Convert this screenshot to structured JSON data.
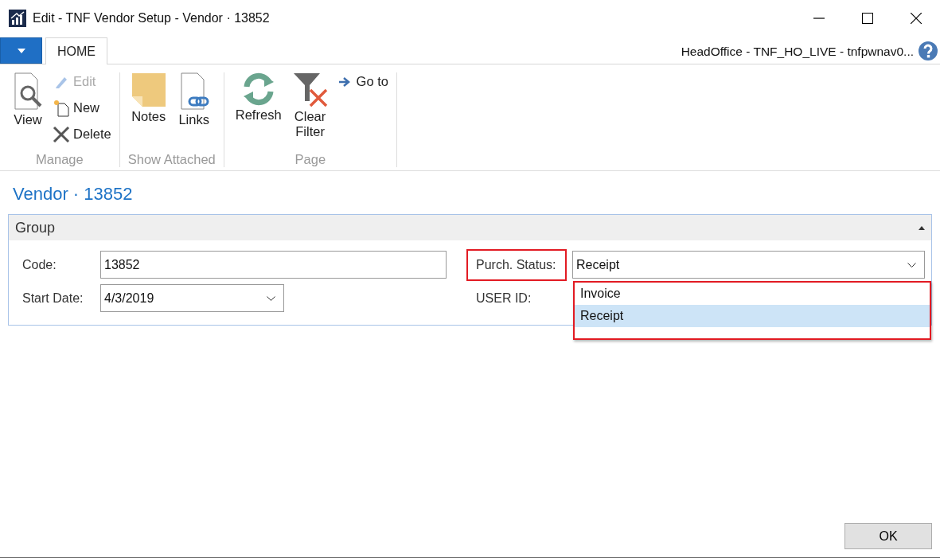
{
  "window": {
    "title": "Edit - TNF Vendor Setup - Vendor · 13852"
  },
  "tabs": [
    {
      "label": "HOME",
      "selected": true
    }
  ],
  "connection": "HeadOffice - TNF_HO_LIVE - tnfpwnav0...",
  "ribbon": [
    {
      "label": "Manage",
      "items": [
        {
          "label": "View",
          "kind": "large",
          "disabled": false
        },
        {
          "label": "Edit",
          "kind": "small",
          "disabled": true
        },
        {
          "label": "New",
          "kind": "small",
          "disabled": false
        },
        {
          "label": "Delete",
          "kind": "small",
          "disabled": false
        }
      ]
    },
    {
      "label": "Show Attached",
      "items": [
        {
          "label": "Notes",
          "kind": "large",
          "disabled": false
        },
        {
          "label": "Links",
          "kind": "large",
          "disabled": false
        }
      ]
    },
    {
      "label": "Page",
      "items": [
        {
          "label": "Refresh",
          "kind": "large",
          "disabled": false
        },
        {
          "label": "Clear Filter",
          "kind": "large",
          "disabled": false
        },
        {
          "label": "Go to",
          "kind": "small",
          "disabled": false
        }
      ]
    }
  ],
  "page_title": "Vendor · 13852",
  "group": {
    "title": "Group",
    "expanded": true,
    "left_fields": [
      {
        "label": "Code:",
        "value": "13852",
        "kind": "text",
        "highlighted": false
      },
      {
        "label": "Start Date:",
        "value": "4/3/2019",
        "kind": "date",
        "highlighted": false
      }
    ],
    "right_fields": [
      {
        "label": "Purch. Status:",
        "value": "Receipt",
        "kind": "select",
        "highlighted": true,
        "open": true,
        "options": [
          {
            "label": "Invoice",
            "selected": false
          },
          {
            "label": "Receipt",
            "selected": true
          }
        ]
      },
      {
        "label": "USER ID:",
        "kind": "hidden",
        "highlighted": false
      }
    ]
  },
  "buttons": [
    "OK"
  ]
}
